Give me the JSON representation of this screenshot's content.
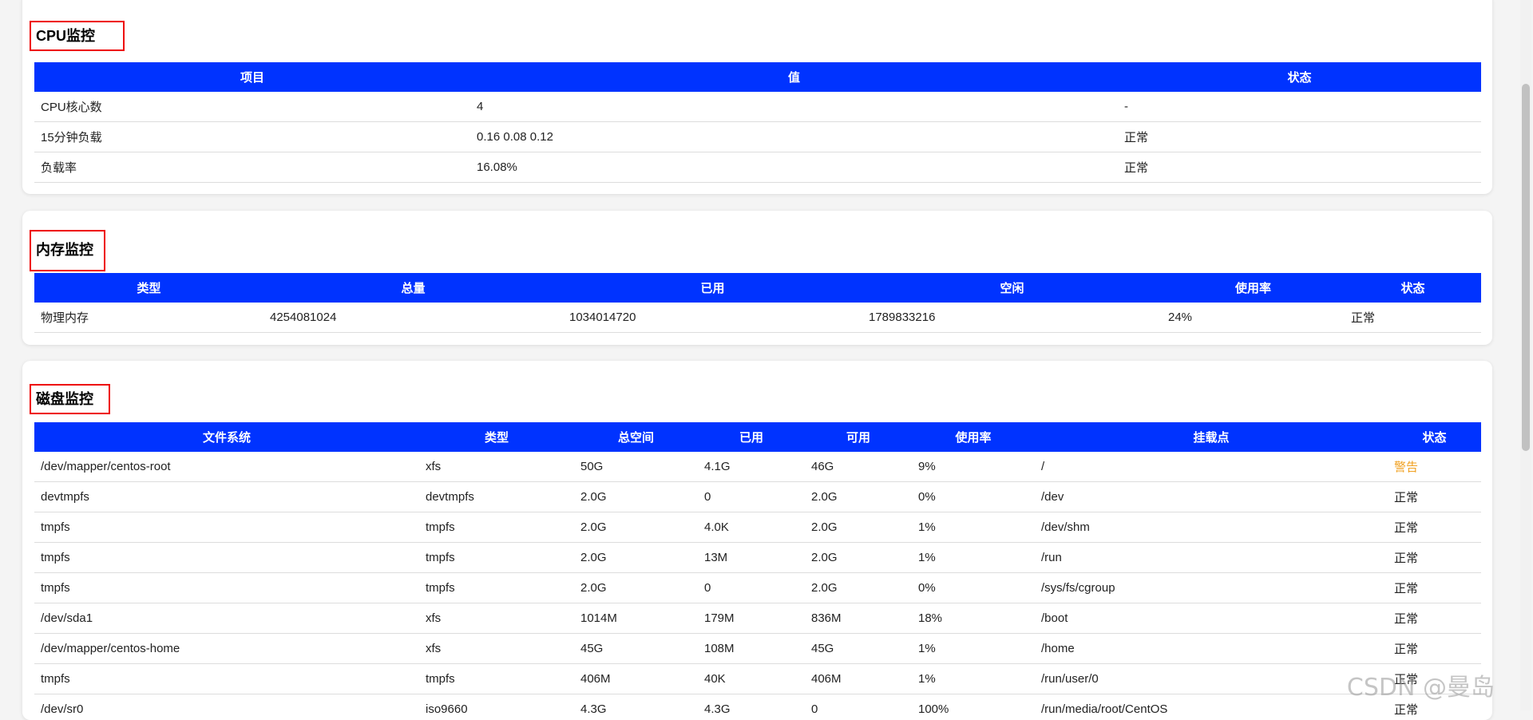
{
  "cpu": {
    "title": "CPU监控",
    "headers": [
      "项目",
      "值",
      "状态"
    ],
    "rows": [
      [
        "CPU核心数",
        "4",
        "-"
      ],
      [
        "15分钟负载",
        "0.16 0.08 0.12",
        "正常"
      ],
      [
        "负载率",
        "16.08%",
        "正常"
      ]
    ]
  },
  "memory": {
    "title": "内存监控",
    "headers": [
      "类型",
      "总量",
      "已用",
      "空闲",
      "使用率",
      "状态"
    ],
    "rows": [
      [
        "物理内存",
        "4254081024",
        "1034014720",
        "1789833216",
        "24%",
        "正常"
      ]
    ]
  },
  "disk": {
    "title": "磁盘监控",
    "headers": [
      "文件系统",
      "类型",
      "总空间",
      "已用",
      "可用",
      "使用率",
      "挂载点",
      "状态"
    ],
    "rows": [
      [
        "/dev/mapper/centos-root",
        "xfs",
        "50G",
        "4.1G",
        "46G",
        "9%",
        "/",
        "警告"
      ],
      [
        "devtmpfs",
        "devtmpfs",
        "2.0G",
        "0",
        "2.0G",
        "0%",
        "/dev",
        "正常"
      ],
      [
        "tmpfs",
        "tmpfs",
        "2.0G",
        "4.0K",
        "2.0G",
        "1%",
        "/dev/shm",
        "正常"
      ],
      [
        "tmpfs",
        "tmpfs",
        "2.0G",
        "13M",
        "2.0G",
        "1%",
        "/run",
        "正常"
      ],
      [
        "tmpfs",
        "tmpfs",
        "2.0G",
        "0",
        "2.0G",
        "0%",
        "/sys/fs/cgroup",
        "正常"
      ],
      [
        "/dev/sda1",
        "xfs",
        "1014M",
        "179M",
        "836M",
        "18%",
        "/boot",
        "正常"
      ],
      [
        "/dev/mapper/centos-home",
        "xfs",
        "45G",
        "108M",
        "45G",
        "1%",
        "/home",
        "正常"
      ],
      [
        "tmpfs",
        "tmpfs",
        "406M",
        "40K",
        "406M",
        "1%",
        "/run/user/0",
        "正常"
      ],
      [
        "/dev/sr0",
        "iso9660",
        "4.3G",
        "4.3G",
        "0",
        "100%",
        "/run/media/root/CentOS",
        "正常"
      ]
    ]
  },
  "status_colors": {
    "warning": "#f0a020",
    "header_bg": "#0033ff"
  },
  "watermark": "CSDN @曼岛"
}
